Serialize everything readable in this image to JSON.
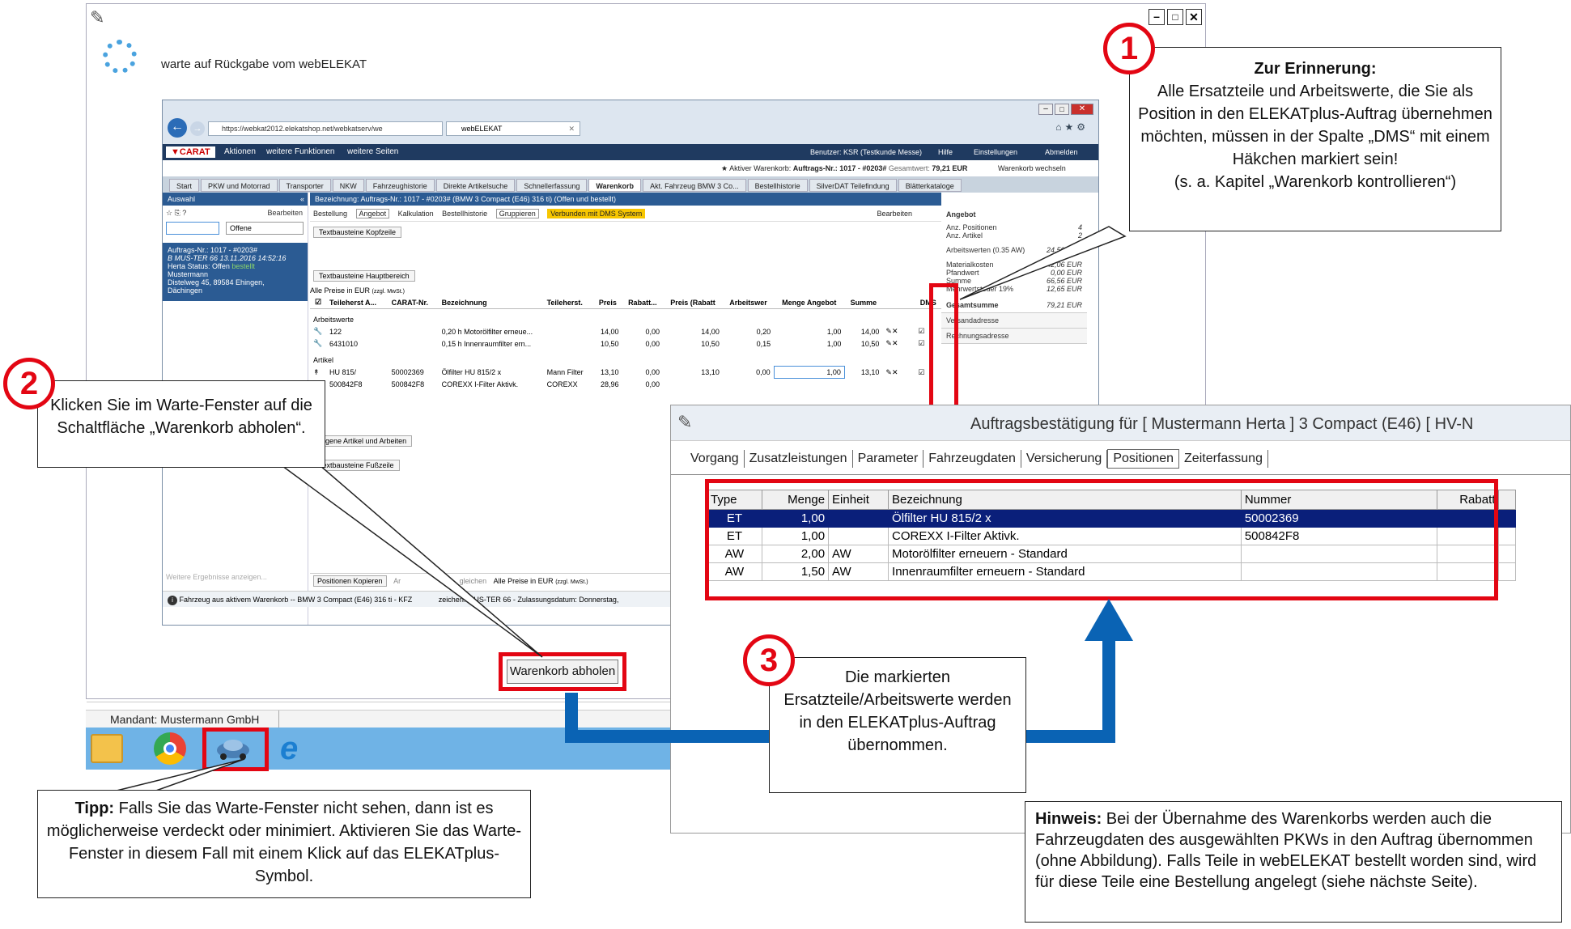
{
  "wait_window": {
    "message": "warte auf Rückgabe vom webELEKAT",
    "pickup_button": "Warenkorb abholen",
    "mandant": "Mandant: Mustermann GmbH"
  },
  "browser": {
    "url": "https://webkat2012.elekatshop.net/webkatserv/we",
    "tab_title": "webELEKAT",
    "app_menu": [
      "Aktionen",
      "weitere Funktionen",
      "weitere Seiten"
    ],
    "user": "Benutzer: KSR (Testkunde Messe)",
    "help": "Hilfe",
    "settings": "Einstellungen",
    "logout": "Abmelden",
    "active_cart": "Aktiver Warenkorb:",
    "active_cart_no": "Auftrags-Nr.: 1017 - #0203#",
    "total_label": "Gesamtwert:",
    "total_value": "79,21 EUR",
    "switch_cart": "Warenkorb wechseln",
    "nav_tabs": [
      "Start",
      "PKW und Motorrad",
      "Transporter",
      "NKW",
      "Fahrzeughistorie",
      "Direkte Artikelsuche",
      "Schnellerfassung",
      "Warenkorb",
      "Akt. Fahrzeug BMW 3 Co...",
      "Bestellhistorie",
      "SilverDAT Teilefindung",
      "Blätterkataloge"
    ],
    "sidebar": {
      "title": "Auswahl",
      "edit": "Bearbeiten",
      "filter": "Offene",
      "order_line1": "Auftrags-Nr.: 1017 - #0203#",
      "order_line2": "B MUS-TER 66 13.11.2016 14:52:16",
      "order_line3": "Herta          Status: Offen",
      "order_status_extra": "bestellt",
      "order_line4": "Mustermann",
      "order_line5": "Distelweg 45, 89584 Ehingen,",
      "order_line6": "Dächingen",
      "more_results": "Weitere Ergebnisse anzeigen..."
    },
    "content": {
      "heading": "Bezeichnung: Auftrags-Nr.: 1017 - #0203# (BMW 3 Compact (E46) 316 ti) (Offen und bestellt)",
      "toolbar": [
        "Bestellung",
        "Angebot",
        "Kalkulation",
        "Bestellhistorie",
        "Gruppieren"
      ],
      "dms_badge": "Verbunden mit DMS System",
      "edit": "Bearbeiten",
      "btn_header_text": "Textbausteine Kopfzeile",
      "btn_main_text": "Textbausteine Hauptbereich",
      "prices_note": "Alle Preise in EUR",
      "prices_note_small": "(zzgl. MwSt.)",
      "columns": [
        "Teileherst A...",
        "CARAT-Nr.",
        "Bezeichnung",
        "Teileherst.",
        "Preis",
        "Rabatt...",
        "Preis (Rabatt",
        "Arbeitswer",
        "Menge Angebot",
        "Summe",
        "DMS"
      ],
      "section_labour": "Arbeitswerte",
      "section_parts": "Artikel",
      "rows": [
        {
          "a": "122",
          "b": "",
          "c": "0,20 h Motorölfilter erneue...",
          "d": "",
          "e": "14,00",
          "f": "0,00",
          "g": "14,00",
          "h": "0,20",
          "i": "1,00",
          "j": "14,00"
        },
        {
          "a": "6431010",
          "b": "",
          "c": "0,15 h Innenraumfilter ern...",
          "d": "",
          "e": "10,50",
          "f": "0,00",
          "g": "10,50",
          "h": "0,15",
          "i": "1,00",
          "j": "10,50"
        },
        {
          "a": "HU 815/",
          "b": "50002369",
          "c": "Ölfilter HU 815/2 x",
          "d": "Mann Filter",
          "e": "13,10",
          "f": "0,00",
          "g": "13,10",
          "h": "0,00",
          "i": "1,00",
          "j": "13,10"
        },
        {
          "a": "500842F8",
          "b": "500842F8",
          "c": "COREXX I-Filter Aktivk.",
          "d": "COREXX",
          "e": "28,96",
          "f": "0,00",
          "g": "",
          "h": "",
          "i": "",
          "j": ""
        }
      ],
      "btn_own_items": "Eigene Artikel und Arbeiten",
      "btn_footer_text": "Textbausteine Fußzeile",
      "btn_copy": "Positionen Kopieren",
      "btn_compare_frag": "Ar",
      "btn_compare_frag2": "gleichen",
      "status_bar": "Fahrzeug aus aktivem Warenkorb -- BMW 3 Compact (E46) 316 ti - KFZ",
      "status_bar2": "zeichen: MUS-TER 66 - Zulassungsdatum: Donnerstag,"
    },
    "summary": {
      "title": "Angebot",
      "rows": [
        {
          "label": "Anz. Positionen",
          "value": "4"
        },
        {
          "label": "Anz. Artikel",
          "value": "2"
        },
        {
          "label": "Arbeitswerten (0.35 AW)",
          "value": "24,50 EUR"
        },
        {
          "label": "Materialkosten",
          "value": "42,06 EUR"
        },
        {
          "label": "Pfandwert",
          "value": "0,00 EUR"
        },
        {
          "label": "Summe",
          "value": "66,56 EUR"
        },
        {
          "label": "Mehrwertsteuer 19%",
          "value": "12,65 EUR"
        },
        {
          "label": "Gesamtsumme",
          "value": "79,21 EUR"
        }
      ],
      "shipping": "Versandadresse",
      "billing": "Rechnungsadresse"
    }
  },
  "order_window": {
    "title": "Auftragsbestätigung  für [ Mustermann Herta ] 3 Compact (E46) [ HV-N",
    "tabs": [
      "Vorgang",
      "Zusatzleistungen",
      "Parameter",
      "Fahrzeugdaten",
      "Versicherung",
      "Positionen",
      "Zeiterfassung"
    ],
    "columns": [
      "Type",
      "Menge",
      "Einheit",
      "Bezeichnung",
      "Nummer",
      "Rabatt"
    ],
    "rows": [
      {
        "type": "ET",
        "menge": "1,00",
        "einheit": "",
        "bez": "Ölfilter HU 815/2 x",
        "nr": "50002369",
        "rabatt": ""
      },
      {
        "type": "ET",
        "menge": "1,00",
        "einheit": "",
        "bez": "COREXX I-Filter Aktivk.",
        "nr": "500842F8",
        "rabatt": ""
      },
      {
        "type": "AW",
        "menge": "2,00",
        "einheit": "AW",
        "bez": "Motorölfilter erneuern - Standard",
        "nr": "",
        "rabatt": ""
      },
      {
        "type": "AW",
        "menge": "1,50",
        "einheit": "AW",
        "bez": "Innenraumfilter erneuern - Standard",
        "nr": "",
        "rabatt": ""
      }
    ]
  },
  "callouts": {
    "c1_num": "1",
    "c1_title": "Zur Erinnerung:",
    "c1_text": "Alle Ersatzteile und Arbeitswerte, die Sie als Position in den ELEKATplus-Auftrag übernehmen möchten, müssen in der Spalte „DMS“ mit einem Häkchen markiert sein!",
    "c1_ref": "(s. a. Kapitel „Warenkorb kontrollieren“)",
    "c2_num": "2",
    "c2_text": "Klicken Sie im Warte-Fenster auf die Schaltfläche „Warenkorb abholen“.",
    "c3_num": "3",
    "c3_text": "Die markierten Ersatzteile/Arbeitswerte werden in den ELEKATplus-Auftrag übernommen.",
    "tip_bold": "Tipp:",
    "tip_text": " Falls Sie das Warte-Fenster nicht sehen, dann ist es möglicherweise verdeckt oder minimiert. Aktivieren Sie das Warte-Fenster in diesem Fall mit einem Klick auf das ELEKATplus-Symbol.",
    "note_bold": "Hinweis:",
    "note_text": " Bei der Übernahme des Warenkorbs werden auch die Fahrzeugdaten des ausgewählten PKWs in den Auftrag übernommen (ohne Abbildung). Falls Teile in webELEKAT bestellt worden sind, wird für diese Teile eine Bestellung angelegt (siehe nächste Seite)."
  },
  "colors": {
    "accent_red": "#e30613",
    "arrow_blue": "#0a63b4",
    "selection_navy": "#0a1f7a",
    "app_bar": "#1f3a60"
  }
}
